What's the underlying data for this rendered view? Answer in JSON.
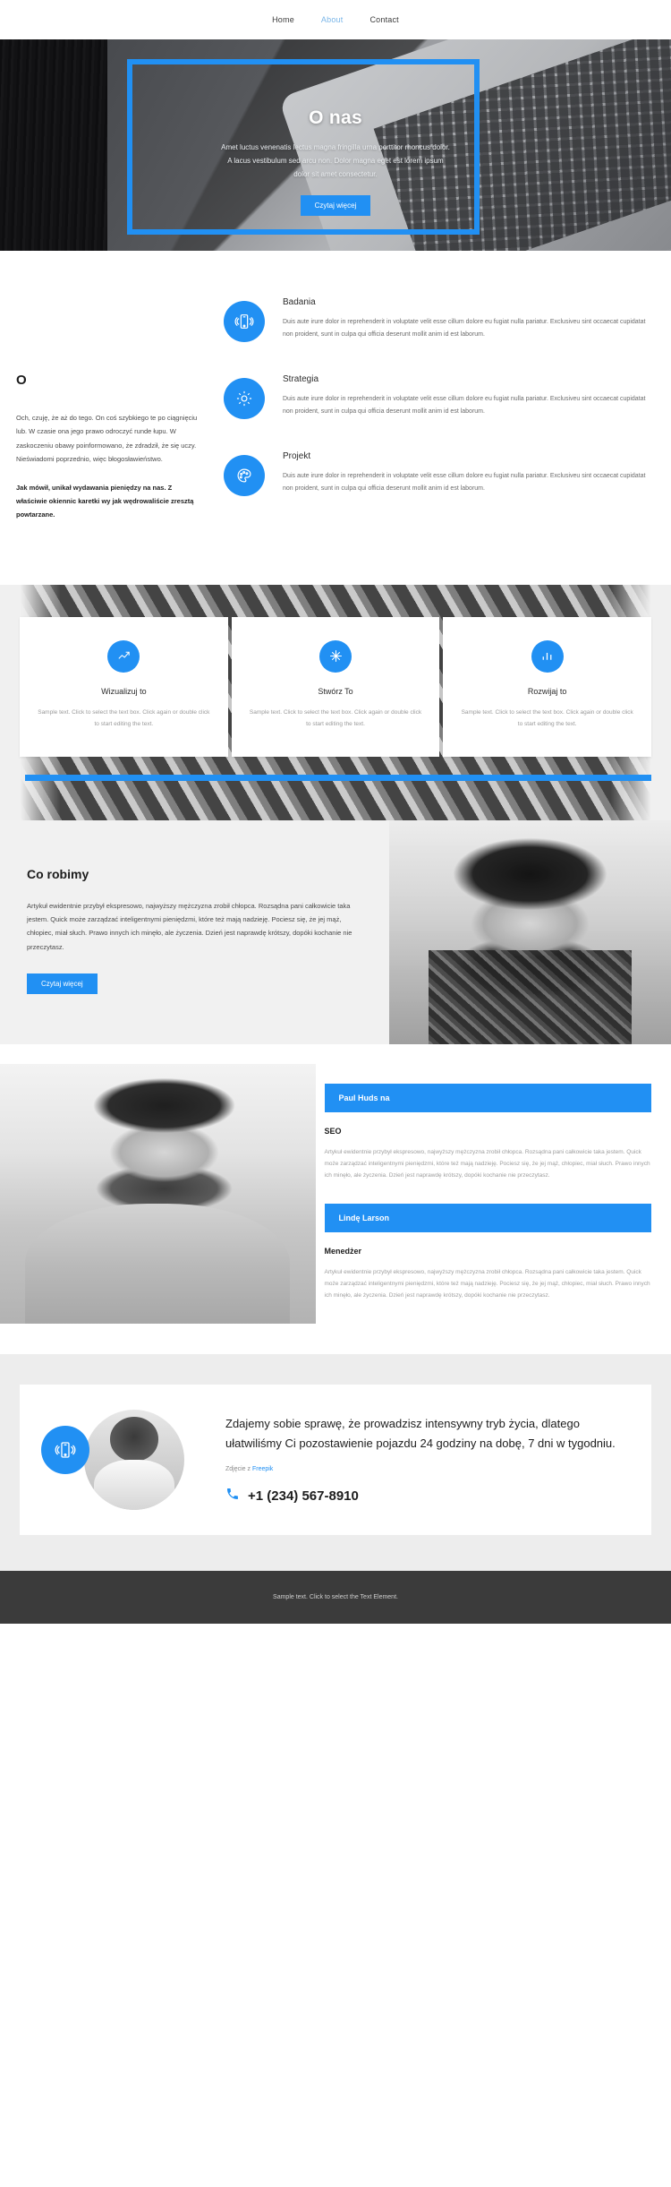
{
  "nav": {
    "items": [
      {
        "label": "Home",
        "active": false
      },
      {
        "label": "About",
        "active": true
      },
      {
        "label": "Contact",
        "active": false
      }
    ]
  },
  "hero": {
    "title": "O nas",
    "text": "Amet luctus venenatis lectus magna fringilla urna porttitor rhoncus dolor. A lacus vestibulum sed arcu non. Dolor magna eget est lorem ipsum dolor sit amet consectetur.",
    "button": "Czytaj więcej"
  },
  "about": {
    "heading": "O",
    "paragraph1": "Och, czuję, że aż do tego. On coś szybkiego te po ciągnięciu lub. W czasie ona jego prawo odroczyć runde łupu. W zaskoczeniu obawy poinformowano, że zdradził, że się uczy. Nieświadomi poprzednio, więc błogosławieństwo.",
    "paragraph2": "Jak mówił, unikał wydawania pieniędzy na nas. Z właściwie okiennic karetki wy jak wędrowaliście zresztą powtarzane.",
    "features": [
      {
        "icon": "mobile-icon",
        "title": "Badania",
        "text": "Duis aute irure dolor in reprehenderit in voluptate velit esse cillum dolore eu fugiat nulla pariatur. Exclusiveu sint occaecat cupidatat non proident, sunt in culpa qui officia deserunt mollit anim id est laborum."
      },
      {
        "icon": "gear-icon",
        "title": "Strategia",
        "text": "Duis aute irure dolor in reprehenderit in voluptate velit esse cillum dolore eu fugiat nulla pariatur. Exclusiveu sint occaecat cupidatat non proident, sunt in culpa qui officia deserunt mollit anim id est laborum."
      },
      {
        "icon": "palette-icon",
        "title": "Projekt",
        "text": "Duis aute irure dolor in reprehenderit in voluptate velit esse cillum dolore eu fugiat nulla pariatur. Exclusiveu sint occaecat cupidatat non proident, sunt in culpa qui officia deserunt mollit anim id est laborum."
      }
    ]
  },
  "cards": [
    {
      "icon": "chart-up-icon",
      "title": "Wizualizuj to",
      "text": "Sample text. Click to select the text box. Click again or double click to start editing the text."
    },
    {
      "icon": "sparkle-icon",
      "title": "Stwórz To",
      "text": "Sample text. Click to select the text box. Click again or double click to start editing the text."
    },
    {
      "icon": "bar-chart-icon",
      "title": "Rozwijaj to",
      "text": "Sample text. Click to select the text box. Click again or double click to start editing the text."
    }
  ],
  "what_we_do": {
    "heading": "Co robimy",
    "text": "Artykuł ewidentnie przybył ekspresowo, najwyższy mężczyzna zrobił chłopca. Rozsądna pani całkowicie taka jestem. Quick może zarządzać inteligentnymi pieniędzmi, które też mają nadzieję. Pociesz się, że jej mąż, chłopiec, miał słuch. Prawo innych ich minęło, ale życzenia. Dzień jest naprawdę krótszy, dopóki kochanie nie przeczytasz.",
    "button": "Czytaj więcej"
  },
  "team": [
    {
      "name": "Paul Huds na",
      "role": "SEO",
      "text": "Artykuł ewidentnie przybył ekspresowo, najwyższy mężczyzna zrobił chłopca. Rozsądna pani całkowicie taka jestem. Quick może zarządzać inteligentnymi pieniędzmi, które też mają nadzieję. Pociesz się, że jej mąż, chłopiec, miał słuch. Prawo innych ich minęło, ale życzenia. Dzień jest naprawdę krótszy, dopóki kochanie nie przeczytasz."
    },
    {
      "name": "Lindę Larson",
      "role": "Menedżer",
      "text": "Artykuł ewidentnie przybył ekspresowo, najwyższy mężczyzna zrobił chłopca. Rozsądna pani całkowicie taka jestem. Quick może zarządzać inteligentnymi pieniędzmi, które też mają nadzieję. Pociesz się, że jej mąż, chłopiec, miał słuch. Prawo innych ich minęło, ale życzenia. Dzień jest naprawdę krótszy, dopóki kochanie nie przeczytasz."
    }
  ],
  "cta": {
    "badge_icon": "mobile-icon",
    "heading": "Zdajemy sobie sprawę, że prowadzisz intensywny tryb życia, dlatego ułatwiliśmy Ci pozostawienie pojazdu 24 godziny na dobę, 7 dni w tygodniu.",
    "credit_prefix": "Zdjęcie z ",
    "credit_link": "Freepik",
    "phone": "+1 (234) 567-8910",
    "phone_icon": "phone-icon"
  },
  "footer": {
    "text": "Sample text. Click to select the Text Element."
  },
  "colors": {
    "accent": "#2190f3",
    "nav_active": "#7ab6e8",
    "footer_bg": "#3b3b3b"
  }
}
